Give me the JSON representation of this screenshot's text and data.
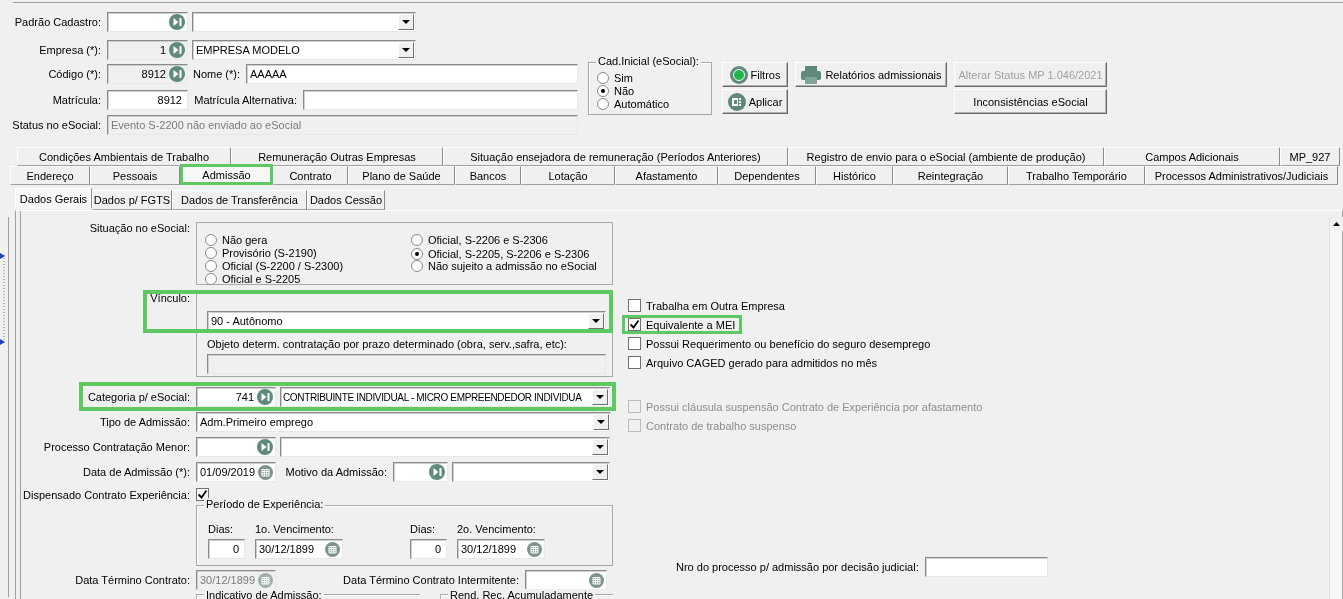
{
  "top_form": {
    "padrao_cadastro": {
      "label": "Padrão Cadastro:"
    },
    "empresa": {
      "label": "Empresa (*):",
      "code": "1",
      "description": "EMPRESA MODELO"
    },
    "codigo": {
      "label": "Código (*):",
      "code": "8912"
    },
    "nome": {
      "label": "Nome (*):",
      "value": "AAAAA"
    },
    "matricula": {
      "label": "Matrícula:",
      "value": "8912"
    },
    "matricula_alternativa": {
      "label": "Matrícula Alternativa:"
    },
    "status": {
      "label": "Status no eSocial:",
      "value": "Evento S-2200 não enviado ao eSocial",
      "disabled": true
    }
  },
  "cad_inicial": {
    "title": "Cad.Inicial (eSocial):",
    "options": [
      {
        "label": "Sim",
        "selected": false
      },
      {
        "label": "Não",
        "selected": true
      },
      {
        "label": "Automático",
        "selected": false
      }
    ]
  },
  "buttons": [
    {
      "label": "Filtros",
      "kind": "filter",
      "disabled": false
    },
    {
      "label": "Aplicar",
      "kind": "apply",
      "disabled": false
    },
    {
      "label": "Relatórios admissionais",
      "kind": "print",
      "disabled": false
    },
    {
      "label": "Alterar Status MP 1.046/2021",
      "kind": "plain",
      "disabled": true
    },
    {
      "label": "Inconsistências eSocial",
      "kind": "plain",
      "disabled": false
    }
  ],
  "tab_rows": [
    [
      {
        "label": "Condições Ambientais de Trabalho",
        "selected": false,
        "highlighted": false
      },
      {
        "label": "Remuneração Outras Empresas",
        "selected": false,
        "highlighted": false
      },
      {
        "label": "Situação ensejadora de remuneração (Períodos Anteriores)",
        "selected": false,
        "highlighted": false
      },
      {
        "label": "Registro de envio para o eSocial (ambiente de produção)",
        "selected": false,
        "highlighted": false
      },
      {
        "label": "Campos Adicionais",
        "selected": false,
        "highlighted": false
      },
      {
        "label": "MP_927",
        "selected": false,
        "highlighted": false
      }
    ],
    [
      {
        "label": "Endereço",
        "selected": false,
        "highlighted": false
      },
      {
        "label": "Pessoais",
        "selected": false,
        "highlighted": false
      },
      {
        "label": "Admissão",
        "selected": true,
        "highlighted": true
      },
      {
        "label": "Contrato",
        "selected": false,
        "highlighted": false
      },
      {
        "label": "Plano de Saúde",
        "selected": false,
        "highlighted": false
      },
      {
        "label": "Bancos",
        "selected": false,
        "highlighted": false
      },
      {
        "label": "Lotação",
        "selected": false,
        "highlighted": false
      },
      {
        "label": "Afastamento",
        "selected": false,
        "highlighted": false
      },
      {
        "label": "Dependentes",
        "selected": false,
        "highlighted": false
      },
      {
        "label": "Histórico",
        "selected": false,
        "highlighted": false
      },
      {
        "label": "Reintegração",
        "selected": false,
        "highlighted": false
      },
      {
        "label": "Trabalho Temporário",
        "selected": false,
        "highlighted": false
      },
      {
        "label": "Processos Administrativos/Judiciais",
        "selected": false,
        "highlighted": false
      }
    ]
  ],
  "sub_tabs": [
    {
      "label": "Dados Gerais",
      "selected": true
    },
    {
      "label": "Dados p/ FGTS",
      "selected": false
    },
    {
      "label": "Dados de Transferência",
      "selected": false
    },
    {
      "label": "Dados Cessão",
      "selected": false
    }
  ],
  "content": {
    "situacao": {
      "label": "Situação no eSocial:",
      "options": [
        {
          "label": "Não gera",
          "selected": false
        },
        {
          "label": "Provisório (S-2190)",
          "selected": false
        },
        {
          "label": "Oficial (S-2200 / S-2300)",
          "selected": false
        },
        {
          "label": "Oficial e S-2205",
          "selected": false
        },
        {
          "label": "Oficial, S-2206 e S-2306",
          "selected": false
        },
        {
          "label": "Oficial, S-2205, S-2206 e S-2306",
          "selected": true
        },
        {
          "label": "Não sujeito a admissão no eSocial",
          "selected": false
        }
      ]
    },
    "vinculo": {
      "label": "Vínculo:",
      "value": "90 - Autônomo",
      "highlighted": true
    },
    "objeto": {
      "label": "Objeto determ. contratação por prazo determinado (obra, serv.,safra, etc):"
    },
    "categoria": {
      "label": "Categoria p/ eSocial:",
      "code": "741",
      "description": "CONTRIBUINTE INDIVIDUAL - MICRO EMPREENDEDOR INDIVIDUA",
      "highlighted": true
    },
    "tipo_admissao": {
      "label": "Tipo de Admissão:",
      "value": "Adm.Primeiro emprego"
    },
    "processo_menor": {
      "label": "Processo Contratação Menor:"
    },
    "data_admissao": {
      "label": "Data de Admissão (*):",
      "value": "01/09/2019"
    },
    "motivo": {
      "label": "Motivo da Admissão:"
    },
    "dispensado": {
      "label": "Dispensado Contrato Experiência:",
      "checked": true
    },
    "periodo": {
      "title": "Período de Experiência:",
      "first": {
        "days_label": "Dias:",
        "days": "0",
        "due_label": "1o. Vencimento:",
        "due": "30/12/1899"
      },
      "second": {
        "days_label": "Dias:",
        "days": "0",
        "due_label": "2o. Vencimento:",
        "due": "30/12/1899"
      }
    },
    "data_termino": {
      "label": "Data Término Contrato:",
      "value": "30/12/1899",
      "disabled": true
    },
    "data_termino_intermitente": {
      "label": "Data Término Contrato Intermitente:"
    },
    "group_titles": [
      "Indicativo de Admissão:",
      "Rend. Rec. Acumuladamente"
    ],
    "checks_upper": [
      {
        "label": "Trabalha em Outra Empresa",
        "checked": false,
        "disabled": false,
        "highlighted": false
      },
      {
        "label": "Equivalente a MEI",
        "checked": true,
        "disabled": false,
        "highlighted": true
      },
      {
        "label": "Possui Requerimento ou benefício do seguro desemprego",
        "checked": false,
        "disabled": false,
        "highlighted": false
      },
      {
        "label": "Arquivo CAGED gerado para admitidos no mês",
        "checked": false,
        "disabled": false,
        "highlighted": false
      }
    ],
    "checks_lower": [
      {
        "label": "Possui cláusula suspensão Contrato de Experiência por afastamento",
        "checked": false,
        "disabled": true,
        "highlighted": false
      },
      {
        "label": "Contrato de trabalho suspenso",
        "checked": false,
        "disabled": true,
        "highlighted": false
      }
    ],
    "processo_judicial": {
      "label": "Nro do processo p/ admissão por decisão judicial:"
    }
  }
}
